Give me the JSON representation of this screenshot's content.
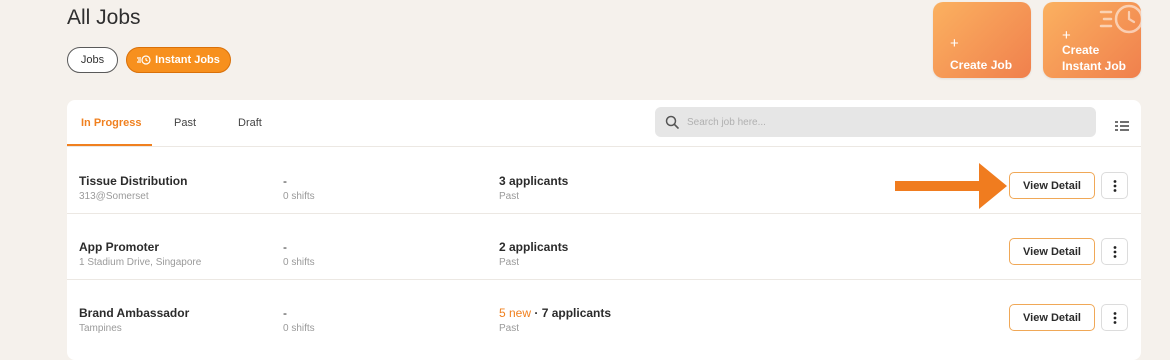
{
  "header": {
    "title": "All Jobs",
    "filters": [
      {
        "label": "Jobs",
        "active": false
      },
      {
        "label": "Instant Jobs",
        "active": true
      }
    ]
  },
  "actions": {
    "create_job": {
      "plus": "+",
      "label": "Create Job"
    },
    "create_instant_job": {
      "plus": "+",
      "line1": "Create",
      "line2": "Instant Job"
    }
  },
  "tabs": [
    {
      "label": "In Progress",
      "active": true
    },
    {
      "label": "Past",
      "active": false
    },
    {
      "label": "Draft",
      "active": false
    }
  ],
  "search": {
    "placeholder": "Search job here..."
  },
  "jobs": [
    {
      "title": "Tissue Distribution",
      "location": "313@Somerset",
      "dash": "-",
      "shifts": "0 shifts",
      "new": "",
      "applicants": "3 applicants",
      "status": "Past",
      "action": "View Detail"
    },
    {
      "title": "App Promoter",
      "location": "1 Stadium Drive, Singapore",
      "dash": "-",
      "shifts": "0 shifts",
      "new": "",
      "applicants": "2 applicants",
      "status": "Past",
      "action": "View Detail"
    },
    {
      "title": "Brand Ambassador",
      "location": "Tampines",
      "dash": "-",
      "shifts": "0 shifts",
      "new": "5 new",
      "applicants": "7 applicants",
      "status": "Past",
      "action": "View Detail"
    }
  ],
  "colors": {
    "accent": "#f0801f",
    "background": "#f5f1ec"
  }
}
